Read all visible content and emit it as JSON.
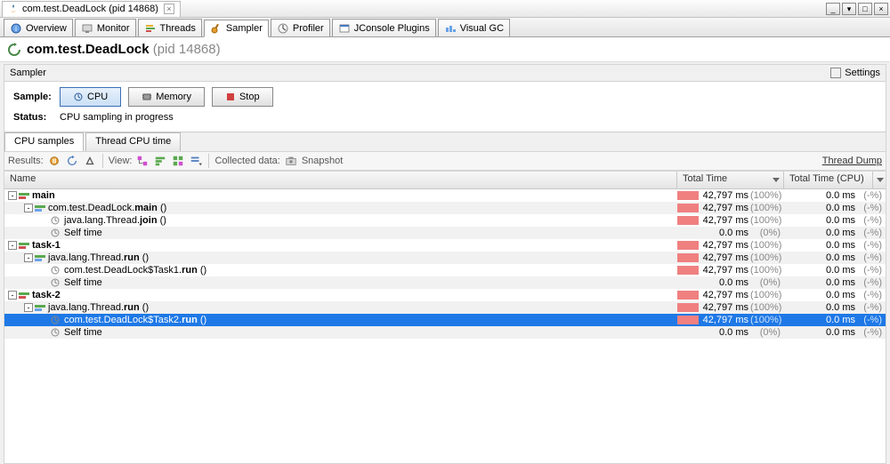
{
  "window": {
    "title_prefix": "com.test.DeadLock",
    "title_pid": "(pid 14868)"
  },
  "tabs": {
    "overview": "Overview",
    "monitor": "Monitor",
    "threads": "Threads",
    "sampler": "Sampler",
    "profiler": "Profiler",
    "jconsole": "JConsole Plugins",
    "visualgc": "Visual GC"
  },
  "header": {
    "title": "com.test.DeadLock",
    "pid": "(pid 14868)"
  },
  "sampler_box": {
    "label": "Sampler",
    "settings": "Settings"
  },
  "controls": {
    "sample_lbl": "Sample:",
    "cpu_btn": "CPU",
    "memory_btn": "Memory",
    "stop_btn": "Stop",
    "status_lbl": "Status:",
    "status_msg": "CPU sampling in progress"
  },
  "subtabs": {
    "cpu_samples": "CPU samples",
    "thread_cpu": "Thread CPU time"
  },
  "toolbar": {
    "results": "Results:",
    "view": "View:",
    "collected": "Collected data:",
    "snapshot": "Snapshot",
    "thread_dump": "Thread Dump"
  },
  "columns": {
    "name": "Name",
    "total_time": "Total Time",
    "total_time_cpu": "Total Time (CPU)"
  },
  "tree": [
    {
      "depth": 0,
      "expand": "-",
      "icon": "thread",
      "label_pre": "",
      "bold": "main",
      "label_post": "",
      "tt": "42,797 ms",
      "ttp": "(100%)",
      "ttc": "0.0 ms",
      "ttcp": "(-%)",
      "bar": true,
      "alt": false,
      "sel": false
    },
    {
      "depth": 1,
      "expand": "-",
      "icon": "method",
      "label_pre": "com.test.DeadLock.",
      "bold": "main",
      "label_post": " ()",
      "tt": "42,797 ms",
      "ttp": "(100%)",
      "ttc": "0.0 ms",
      "ttcp": "(-%)",
      "bar": true,
      "alt": true,
      "sel": false
    },
    {
      "depth": 2,
      "expand": " ",
      "icon": "clock",
      "label_pre": "java.lang.Thread.",
      "bold": "join",
      "label_post": " ()",
      "tt": "42,797 ms",
      "ttp": "(100%)",
      "ttc": "0.0 ms",
      "ttcp": "(-%)",
      "bar": true,
      "alt": false,
      "sel": false
    },
    {
      "depth": 2,
      "expand": " ",
      "icon": "clock",
      "label_pre": "",
      "bold": "",
      "label_post": "Self time",
      "tt": "0.0 ms",
      "ttp": "(0%)",
      "ttc": "0.0 ms",
      "ttcp": "(-%)",
      "bar": false,
      "alt": true,
      "sel": false
    },
    {
      "depth": 0,
      "expand": "-",
      "icon": "thread",
      "label_pre": "",
      "bold": "task-1",
      "label_post": "",
      "tt": "42,797 ms",
      "ttp": "(100%)",
      "ttc": "0.0 ms",
      "ttcp": "(-%)",
      "bar": true,
      "alt": false,
      "sel": false
    },
    {
      "depth": 1,
      "expand": "-",
      "icon": "method",
      "label_pre": "java.lang.Thread.",
      "bold": "run",
      "label_post": " ()",
      "tt": "42,797 ms",
      "ttp": "(100%)",
      "ttc": "0.0 ms",
      "ttcp": "(-%)",
      "bar": true,
      "alt": true,
      "sel": false
    },
    {
      "depth": 2,
      "expand": " ",
      "icon": "clock",
      "label_pre": "com.test.DeadLock$Task1.",
      "bold": "run",
      "label_post": " ()",
      "tt": "42,797 ms",
      "ttp": "(100%)",
      "ttc": "0.0 ms",
      "ttcp": "(-%)",
      "bar": true,
      "alt": false,
      "sel": false
    },
    {
      "depth": 2,
      "expand": " ",
      "icon": "clock",
      "label_pre": "",
      "bold": "",
      "label_post": "Self time",
      "tt": "0.0 ms",
      "ttp": "(0%)",
      "ttc": "0.0 ms",
      "ttcp": "(-%)",
      "bar": false,
      "alt": true,
      "sel": false
    },
    {
      "depth": 0,
      "expand": "-",
      "icon": "thread",
      "label_pre": "",
      "bold": "task-2",
      "label_post": "",
      "tt": "42,797 ms",
      "ttp": "(100%)",
      "ttc": "0.0 ms",
      "ttcp": "(-%)",
      "bar": true,
      "alt": false,
      "sel": false
    },
    {
      "depth": 1,
      "expand": "-",
      "icon": "method",
      "label_pre": "java.lang.Thread.",
      "bold": "run",
      "label_post": " ()",
      "tt": "42,797 ms",
      "ttp": "(100%)",
      "ttc": "0.0 ms",
      "ttcp": "(-%)",
      "bar": true,
      "alt": true,
      "sel": false
    },
    {
      "depth": 2,
      "expand": " ",
      "icon": "clock",
      "label_pre": "com.test.DeadLock$Task2.",
      "bold": "run",
      "label_post": " ()",
      "tt": "42,797 ms",
      "ttp": "(100%)",
      "ttc": "0.0 ms",
      "ttcp": "(-%)",
      "bar": true,
      "alt": false,
      "sel": true
    },
    {
      "depth": 2,
      "expand": " ",
      "icon": "clock",
      "label_pre": "",
      "bold": "",
      "label_post": "Self time",
      "tt": "0.0 ms",
      "ttp": "(0%)",
      "ttc": "0.0 ms",
      "ttcp": "(-%)",
      "bar": false,
      "alt": true,
      "sel": false
    }
  ]
}
